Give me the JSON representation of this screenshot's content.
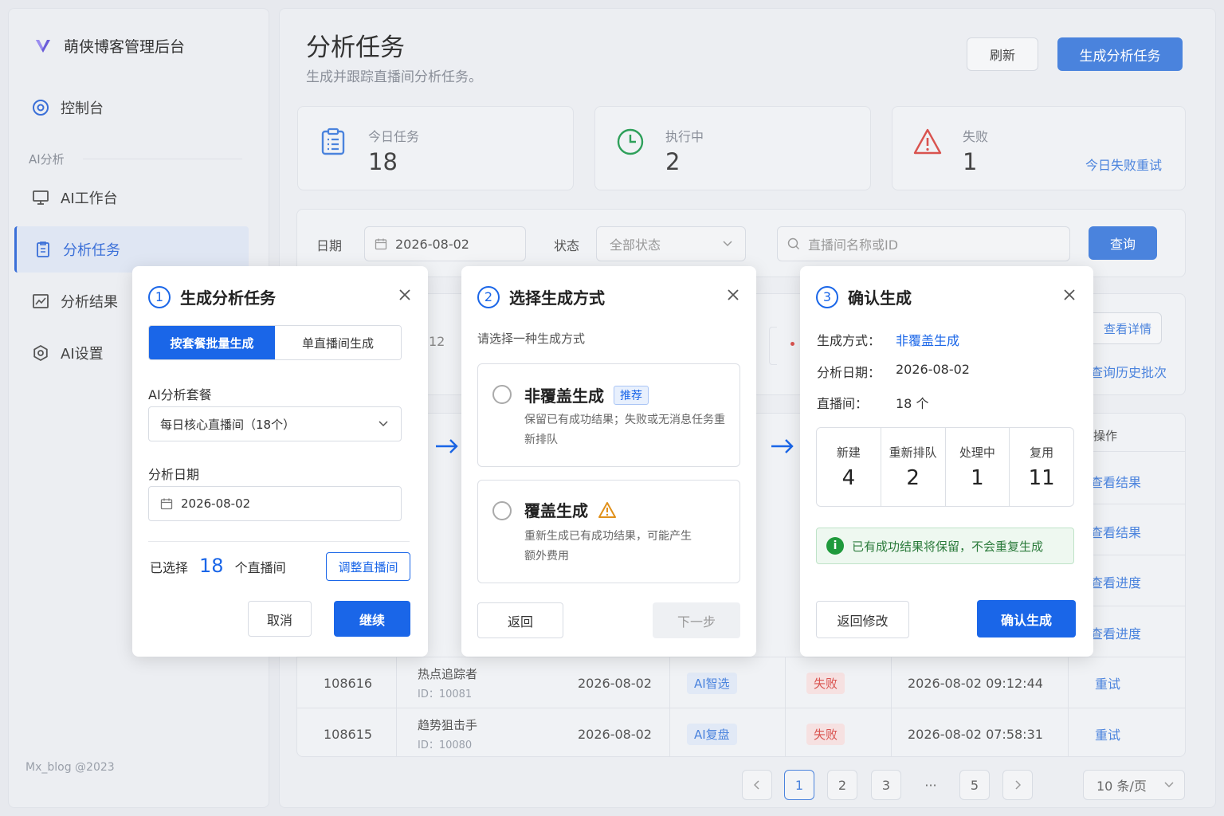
{
  "sidebar": {
    "app_title": "萌侠博客管理后台",
    "items": [
      {
        "label": "控制台"
      },
      {
        "label": "AI工作台"
      },
      {
        "label": "分析任务"
      },
      {
        "label": "分析结果"
      },
      {
        "label": "AI设置"
      }
    ],
    "section_label": "AI分析",
    "footer": "Mx_blog @2023"
  },
  "header": {
    "title": "分析任务",
    "subtitle": "生成并跟踪直播间分析任务。",
    "refresh_label": "刷新",
    "generate_label": "生成分析任务"
  },
  "stats": [
    {
      "label": "今日任务",
      "value": "18",
      "icon": "clipboard-icon"
    },
    {
      "label": "执行中",
      "value": "2",
      "icon": "clock-icon"
    },
    {
      "label": "失败",
      "value": "1",
      "icon": "warning-icon",
      "link": "今日失败重试"
    }
  ],
  "filter": {
    "date_label": "日期",
    "date_value": "2026-08-02",
    "status_label": "状态",
    "status_value": "全部状态",
    "search_placeholder": "直播间名称或ID",
    "query_label": "查询"
  },
  "background_partial": {
    "cell_12": "12",
    "view_detail": "查看详情",
    "query_history": "查询历史批次",
    "op_header": "操作",
    "row_actions": [
      "查看结果",
      "查看结果",
      "查看进度",
      "查看进度"
    ]
  },
  "table": {
    "rows": [
      {
        "id": "108616",
        "name": "热点追踪者",
        "room_id": "ID：10081",
        "date": "2026-08-02",
        "type": "AI智选",
        "status": "失败",
        "time": "2026-08-02 09:12:44",
        "action": "重试"
      },
      {
        "id": "108615",
        "name": "趋势狙击手",
        "room_id": "ID：10080",
        "date": "2026-08-02",
        "type": "AI复盘",
        "status": "失败",
        "time": "2026-08-02 07:58:31",
        "action": "重试"
      }
    ]
  },
  "pagination": {
    "pages": [
      "1",
      "2",
      "3",
      "···",
      "5"
    ],
    "current": "1",
    "page_size": "10 条/页"
  },
  "modal1": {
    "step": "1",
    "title": "生成分析任务",
    "seg_on": "按套餐批量生成",
    "seg_off": "单直播间生成",
    "package_label": "AI分析套餐",
    "package_value": "每日核心直播间（18个）",
    "date_label": "分析日期",
    "date_value": "2026-08-02",
    "selected_prefix": "已选择",
    "selected_count": "18",
    "selected_suffix": "个直播间",
    "adjust_label": "调整直播间",
    "cancel_label": "取消",
    "continue_label": "继续"
  },
  "modal2": {
    "step": "2",
    "title": "选择生成方式",
    "hint": "请选择一种生成方式",
    "opt1_title": "非覆盖生成",
    "opt1_badge": "推荐",
    "opt1_desc": "保留已有成功结果；失败或无消息任务重新排队",
    "opt2_title": "覆盖生成",
    "opt2_desc": "重新生成已有成功结果，可能产生额外费用",
    "back_label": "返回",
    "next_label": "下一步"
  },
  "modal3": {
    "step": "3",
    "title": "确认生成",
    "mode_key": "生成方式：",
    "mode_val": "非覆盖生成",
    "date_key": "分析日期：",
    "date_val": "2026-08-02",
    "room_key": "直播间：",
    "room_val": "18 个",
    "stats": [
      {
        "label": "新建",
        "value": "4"
      },
      {
        "label": "重新排队",
        "value": "2"
      },
      {
        "label": "处理中",
        "value": "1"
      },
      {
        "label": "复用",
        "value": "11"
      }
    ],
    "notice": "已有成功结果将保留，不会重复生成",
    "back_label": "返回修改",
    "confirm_label": "确认生成"
  },
  "colors": {
    "primary": "#1a66e8",
    "accent": "#4a83dd",
    "danger": "#d9534f",
    "success": "#1f9a3c"
  }
}
